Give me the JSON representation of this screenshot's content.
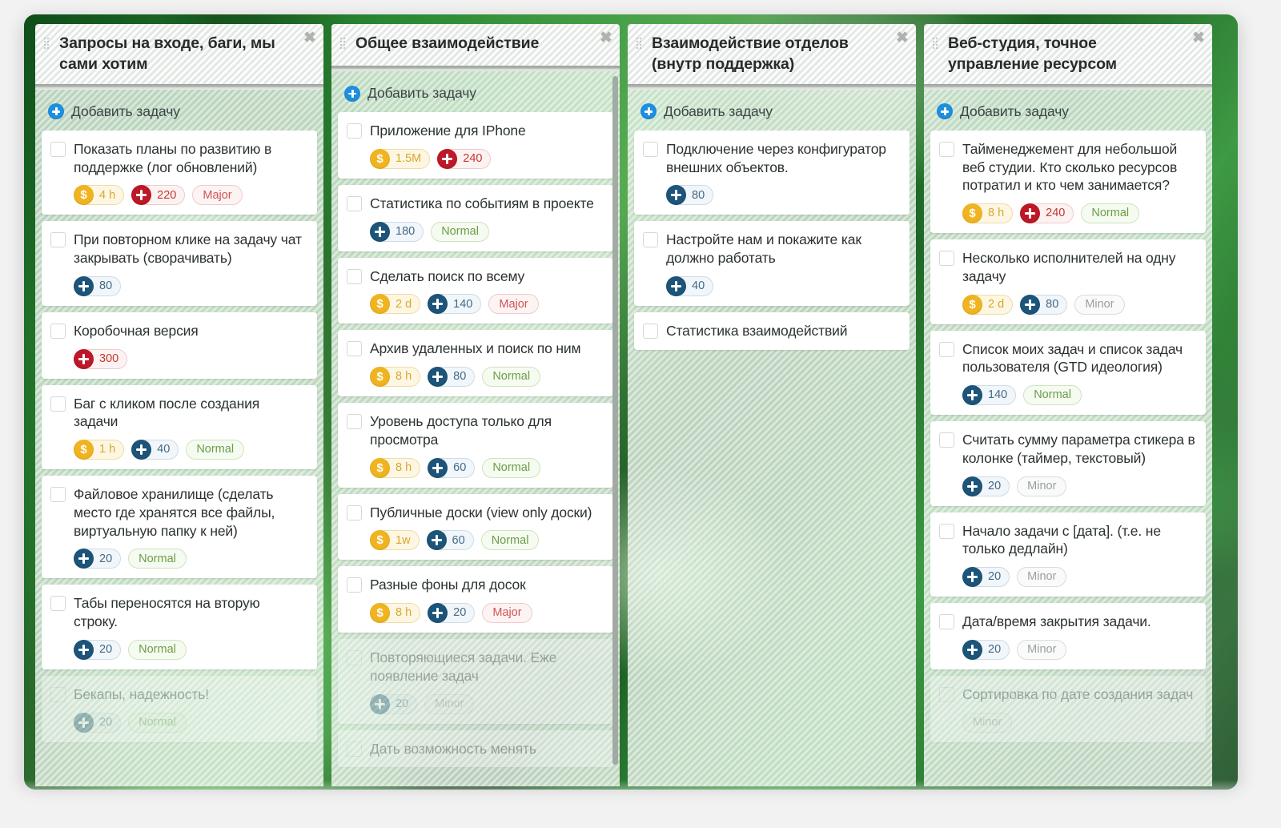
{
  "app": {
    "add_task_label": "Добавить задачу",
    "close_icon": "✖",
    "accent_blue": "#1d8fe0",
    "money_color": "#f0b420",
    "points_color": "#1d5479",
    "points_red_color": "#bd1827",
    "normal_color": "#6a9e45",
    "major_color": "#cf5656",
    "minor_color": "#98a0a0"
  },
  "columns": [
    {
      "title": "Запросы на входе, баги, мы сами хотим",
      "has_scrollbar": false,
      "cards": [
        {
          "title": "Показать планы по развитию в поддержке (лог обновлений)",
          "faded": false,
          "badges": [
            {
              "kind": "money",
              "value": "4 h"
            },
            {
              "kind": "pts-red",
              "value": "220"
            },
            {
              "kind": "prio",
              "variant": "major",
              "value": "Major"
            }
          ]
        },
        {
          "title": "При повторном клике на задачу чат закрывать (сворачивать)",
          "faded": false,
          "badges": [
            {
              "kind": "pts",
              "value": "80"
            }
          ]
        },
        {
          "title": "Коробочная версия",
          "faded": false,
          "badges": [
            {
              "kind": "pts-red",
              "value": "300"
            }
          ]
        },
        {
          "title": "Баг с кликом после создания задачи",
          "faded": false,
          "badges": [
            {
              "kind": "money",
              "value": "1 h"
            },
            {
              "kind": "pts",
              "value": "40"
            },
            {
              "kind": "prio",
              "variant": "normal",
              "value": "Normal"
            }
          ]
        },
        {
          "title": "Файловое хранилище (сделать место где хранятся все файлы, виртуальную папку к ней)",
          "faded": false,
          "badges": [
            {
              "kind": "pts",
              "value": "20"
            },
            {
              "kind": "prio",
              "variant": "normal",
              "value": "Normal"
            }
          ]
        },
        {
          "title": "Табы переносятся на вторую строку.",
          "faded": false,
          "badges": [
            {
              "kind": "pts",
              "value": "20"
            },
            {
              "kind": "prio",
              "variant": "normal",
              "value": "Normal"
            }
          ]
        },
        {
          "title": "Бекапы, надежность!",
          "faded": true,
          "badges": [
            {
              "kind": "pts",
              "value": "20"
            },
            {
              "kind": "prio",
              "variant": "normal",
              "value": "Normal"
            }
          ]
        }
      ]
    },
    {
      "title": "Общее взаимодействие",
      "has_scrollbar": true,
      "cards": [
        {
          "title": "Приложение для IPhone",
          "faded": false,
          "badges": [
            {
              "kind": "money",
              "value": "1.5M"
            },
            {
              "kind": "pts-red",
              "value": "240"
            }
          ]
        },
        {
          "title": "Статистика по событиям в проекте",
          "faded": false,
          "badges": [
            {
              "kind": "pts",
              "value": "180"
            },
            {
              "kind": "prio",
              "variant": "normal",
              "value": "Normal"
            }
          ]
        },
        {
          "title": "Сделать поиск по всему",
          "faded": false,
          "badges": [
            {
              "kind": "money",
              "value": "2 d"
            },
            {
              "kind": "pts",
              "value": "140"
            },
            {
              "kind": "prio",
              "variant": "major",
              "value": "Major"
            }
          ]
        },
        {
          "title": "Архив удаленных и поиск по ним",
          "faded": false,
          "badges": [
            {
              "kind": "money",
              "value": "8 h"
            },
            {
              "kind": "pts",
              "value": "80"
            },
            {
              "kind": "prio",
              "variant": "normal",
              "value": "Normal"
            }
          ]
        },
        {
          "title": "Уровень доступа только для просмотра",
          "faded": false,
          "badges": [
            {
              "kind": "money",
              "value": "8 h"
            },
            {
              "kind": "pts",
              "value": "60"
            },
            {
              "kind": "prio",
              "variant": "normal",
              "value": "Normal"
            }
          ]
        },
        {
          "title": "Публичные доски (view only доски)",
          "faded": false,
          "badges": [
            {
              "kind": "money",
              "value": "1w"
            },
            {
              "kind": "pts",
              "value": "60"
            },
            {
              "kind": "prio",
              "variant": "normal",
              "value": "Normal"
            }
          ]
        },
        {
          "title": "Разные фоны для досок",
          "faded": false,
          "badges": [
            {
              "kind": "money",
              "value": "8 h"
            },
            {
              "kind": "pts",
              "value": "20"
            },
            {
              "kind": "prio",
              "variant": "major",
              "value": "Major"
            }
          ]
        },
        {
          "title": "Повторяющиеся задачи. Еже появление задач",
          "faded": true,
          "badges": [
            {
              "kind": "pts",
              "value": "20"
            },
            {
              "kind": "prio",
              "variant": "minor",
              "value": "Minor"
            }
          ]
        },
        {
          "title": "Дать возможность менять",
          "faded": true,
          "badges": []
        }
      ]
    },
    {
      "title": "Взаимодействие отделов (внутр поддержка)",
      "has_scrollbar": false,
      "cards": [
        {
          "title": "Подключение через конфигуратор внешних объектов.",
          "faded": false,
          "badges": [
            {
              "kind": "pts",
              "value": "80"
            }
          ]
        },
        {
          "title": "Настройте нам и покажите как должно работать",
          "faded": false,
          "badges": [
            {
              "kind": "pts",
              "value": "40"
            }
          ]
        },
        {
          "title": "Статистика взаимодействий",
          "faded": false,
          "badges": []
        }
      ]
    },
    {
      "title": "Веб-студия, точное управление ресурсом",
      "has_scrollbar": false,
      "cards": [
        {
          "title": "Тайменеджемент для небольшой веб студии. Кто сколько ресурсов потратил и кто чем занимается?",
          "faded": false,
          "badges": [
            {
              "kind": "money",
              "value": "8 h"
            },
            {
              "kind": "pts-red",
              "value": "240"
            },
            {
              "kind": "prio",
              "variant": "normal",
              "value": "Normal"
            }
          ]
        },
        {
          "title": "Несколько исполнителей на одну задачу",
          "faded": false,
          "badges": [
            {
              "kind": "money",
              "value": "2 d"
            },
            {
              "kind": "pts",
              "value": "80"
            },
            {
              "kind": "prio",
              "variant": "minor",
              "value": "Minor"
            }
          ]
        },
        {
          "title": "Список моих задач и список задач пользователя (GTD идеология)",
          "faded": false,
          "badges": [
            {
              "kind": "pts",
              "value": "140"
            },
            {
              "kind": "prio",
              "variant": "normal",
              "value": "Normal"
            }
          ]
        },
        {
          "title": "Считать сумму параметра стикера в колонке (таймер, текстовый)",
          "faded": false,
          "badges": [
            {
              "kind": "pts",
              "value": "20"
            },
            {
              "kind": "prio",
              "variant": "minor",
              "value": "Minor"
            }
          ]
        },
        {
          "title": "Начало задачи с [дата]. (т.е. не только дедлайн)",
          "faded": false,
          "badges": [
            {
              "kind": "pts",
              "value": "20"
            },
            {
              "kind": "prio",
              "variant": "minor",
              "value": "Minor"
            }
          ]
        },
        {
          "title": "Дата/время закрытия задачи.",
          "faded": false,
          "badges": [
            {
              "kind": "pts",
              "value": "20"
            },
            {
              "kind": "prio",
              "variant": "minor",
              "value": "Minor"
            }
          ]
        },
        {
          "title": "Сортировка по дате создания задач",
          "faded": true,
          "badges": [
            {
              "kind": "prio",
              "variant": "minor",
              "value": "Minor"
            }
          ]
        }
      ]
    }
  ]
}
